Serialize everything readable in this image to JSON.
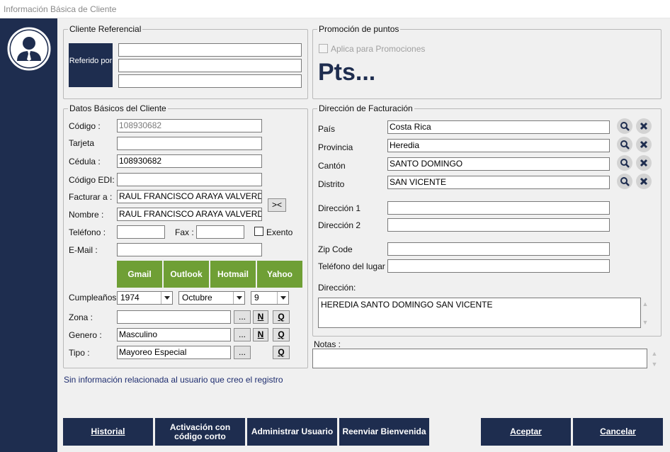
{
  "window": {
    "title": "Información Básica de Cliente"
  },
  "referencial": {
    "group": "Cliente Referencial",
    "button": "Referido por",
    "fields": [
      "",
      "",
      ""
    ]
  },
  "promocion": {
    "group": "Promoción de puntos",
    "checkbox": "Aplica para Promociones",
    "points": "Pts..."
  },
  "datos": {
    "group": "Datos Básicos del Cliente",
    "codigo": {
      "label": "Código :",
      "value": "108930682"
    },
    "tarjeta": {
      "label": "Tarjeta",
      "value": ""
    },
    "cedula": {
      "label": "Cédula :",
      "value": "108930682"
    },
    "codigo_edi": {
      "label": "Código EDI:",
      "value": ""
    },
    "facturar": {
      "label": "Facturar a :",
      "value": "RAUL FRANCISCO ARAYA VALVERDE"
    },
    "nombre": {
      "label": "Nombre :",
      "value": "RAUL FRANCISCO ARAYA VALVERDE"
    },
    "copy_button": "><",
    "telefono": {
      "label": "Teléfono :",
      "value": ""
    },
    "fax": {
      "label": "Fax :",
      "value": ""
    },
    "exento": "Exento",
    "email": {
      "label": "E-Mail :",
      "value": ""
    },
    "mail_buttons": [
      "Gmail",
      "Outlook",
      "Hotmail",
      "Yahoo"
    ],
    "cumpleanos": {
      "label": "Cumpleaños :",
      "year": "1974",
      "month": "Octubre",
      "day": "9"
    },
    "zona": {
      "label": "Zona :",
      "value": ""
    },
    "genero": {
      "label": "Genero :",
      "value": "Masculino"
    },
    "tipo": {
      "label": "Tipo :",
      "value": "Mayoreo Especial"
    },
    "dots": "...",
    "n": "N",
    "q": "Q"
  },
  "facturacion": {
    "group": "Dirección de Facturación",
    "pais": {
      "label": "País",
      "value": "Costa Rica"
    },
    "provincia": {
      "label": "Provincia",
      "value": "Heredia"
    },
    "canton": {
      "label": "Cantón",
      "value": "SANTO DOMINGO"
    },
    "distrito": {
      "label": "Distrito",
      "value": "SAN VICENTE"
    },
    "direccion1": {
      "label": "Dirección 1",
      "value": ""
    },
    "direccion2": {
      "label": "Dirección 2",
      "value": ""
    },
    "zip": {
      "label": "Zip Code",
      "value": ""
    },
    "telefono_lugar": {
      "label": "Teléfono del lugar",
      "value": ""
    },
    "direccion": {
      "label": "Dirección:",
      "value": "HEREDIA SANTO DOMINGO SAN VICENTE"
    }
  },
  "notas": {
    "label": "Notas :",
    "value": ""
  },
  "info_text": "Sin información relacionada al usuario que creo el registro",
  "buttons": {
    "historial": "Historial",
    "activacion": "Activación con código corto",
    "administrar": "Administrar Usuario",
    "reenviar": "Reenviar Bienvenida",
    "aceptar": "Aceptar",
    "cancelar": "Cancelar"
  },
  "colors": {
    "navy": "#1e2d4f",
    "green": "#6f9f35"
  }
}
